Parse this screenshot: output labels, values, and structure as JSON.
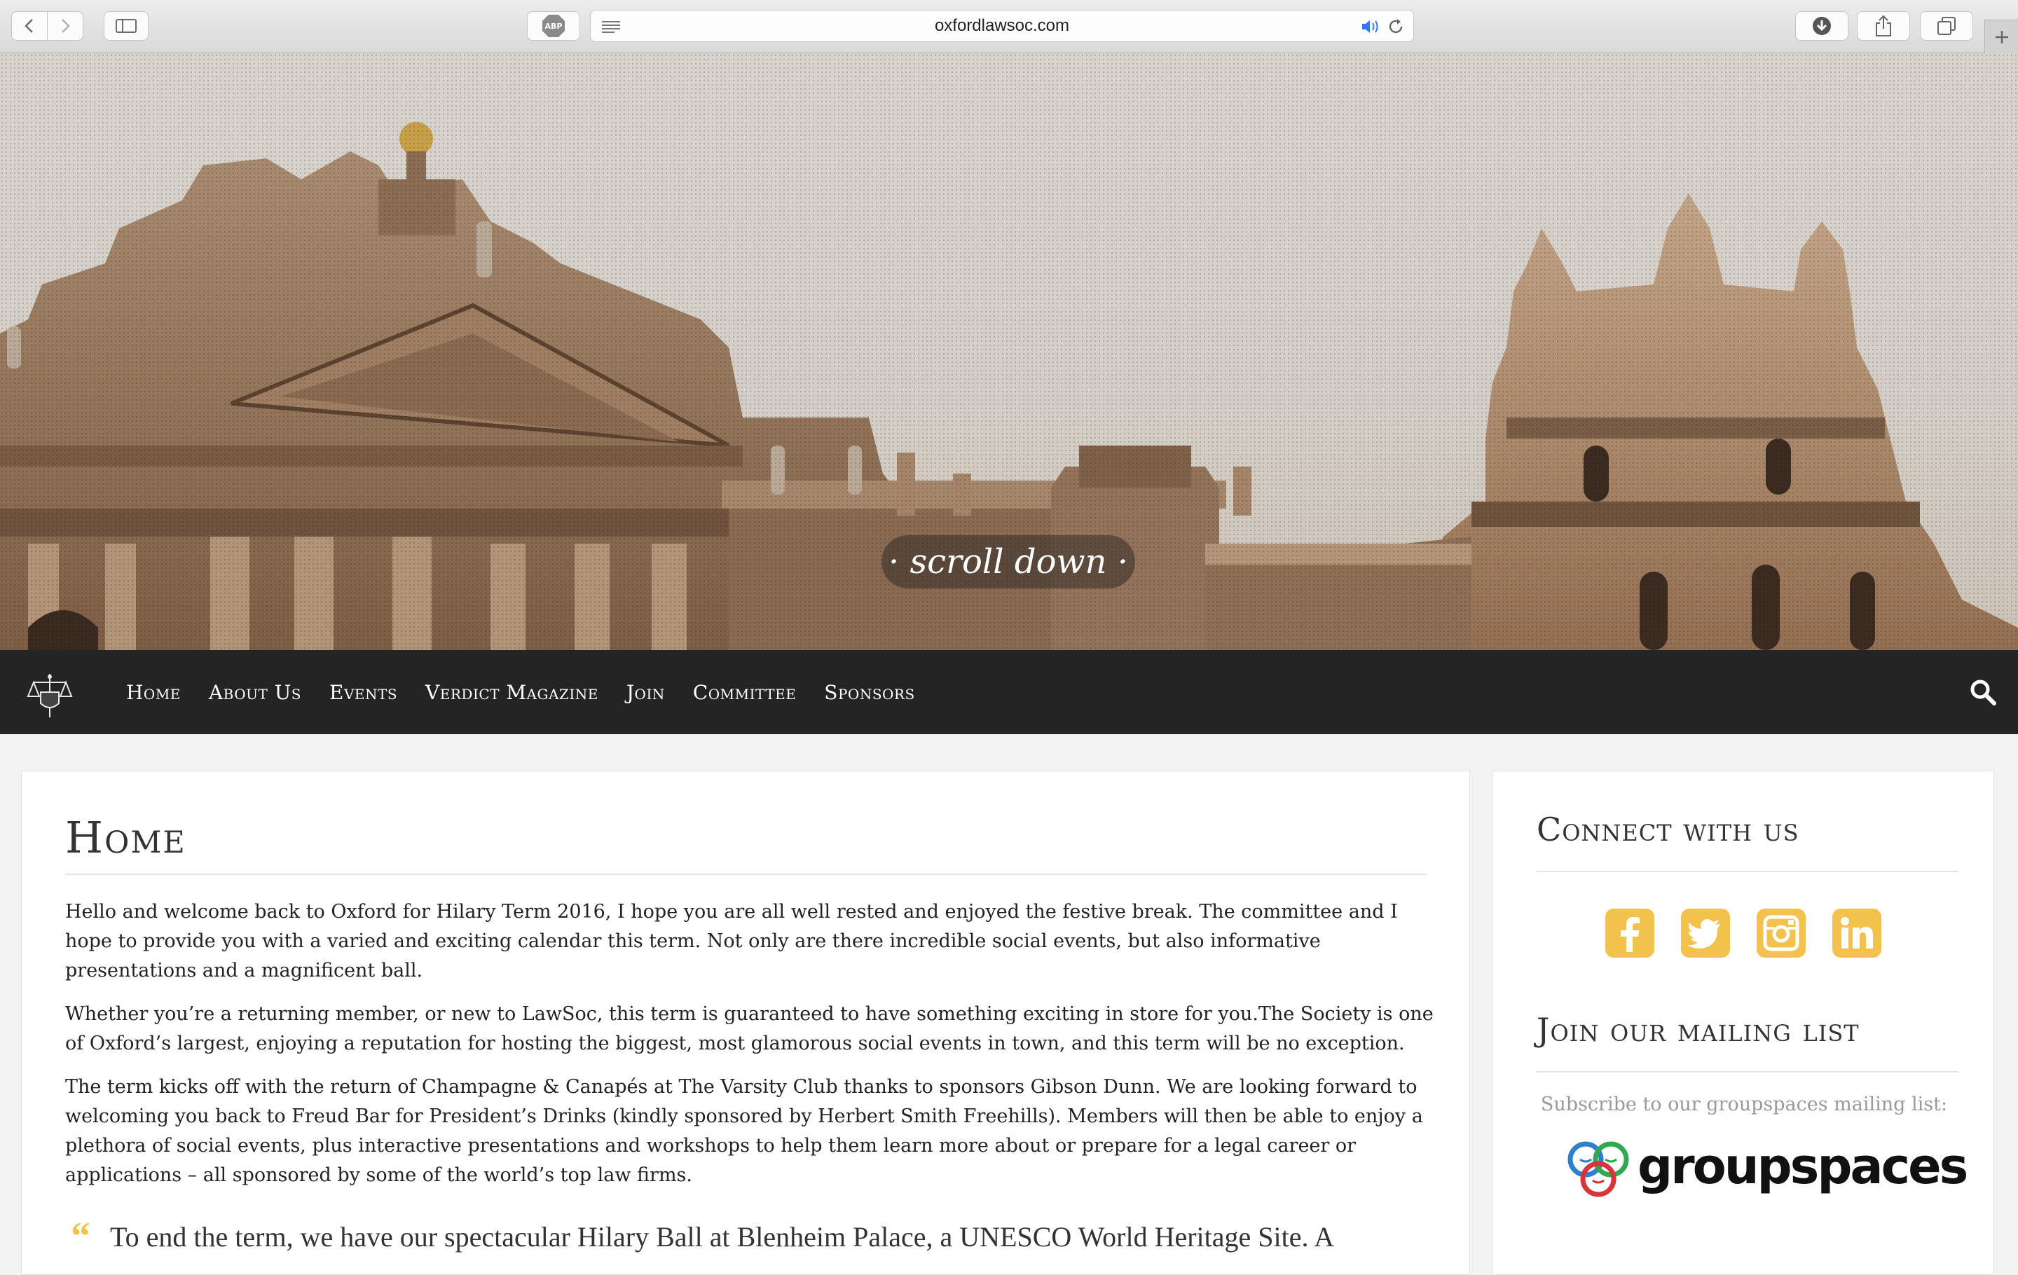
{
  "browser": {
    "url": "oxfordlawsoc.com",
    "abp_label": "ABP"
  },
  "hero": {
    "scroll_label": "· scroll down ·"
  },
  "nav": {
    "items": [
      "Home",
      "About Us",
      "Events",
      "Verdict Magazine",
      "Join",
      "Committee",
      "Sponsors"
    ]
  },
  "main": {
    "title": "Home",
    "paragraphs": [
      "Hello and welcome back to Oxford for Hilary Term 2016, I hope you are all well rested and enjoyed the festive break. The committee and I hope to provide you with a varied and exciting calendar this term. Not only are there incredible social events, but also informative presentations and a magnificent ball.",
      "Whether you’re a returning member, or new to LawSoc, this term is guaranteed to have something exciting in store for you.The Society is one of Oxford’s largest, enjoying a reputation for hosting the biggest, most glamorous social events in town, and this term will be no exception.",
      "The term kicks off with the return of Champagne & Canapés at The Varsity Club thanks to sponsors Gibson Dunn. We are looking forward to welcoming you back to Freud Bar for President’s Drinks (kindly sponsored by Herbert Smith Freehills). Members will then be able to enjoy a plethora of social events, plus interactive presentations and workshops to help them learn more about or prepare for a legal career or applications – all sponsored by some of the world’s top law firms."
    ],
    "quote_mark": "“",
    "quote": "To end the term, we have our spectacular Hilary Ball at Blenheim Palace, a UNESCO World Heritage Site. A"
  },
  "sidebar": {
    "connect_title": "Connect with us",
    "social": [
      "facebook-icon",
      "twitter-icon",
      "instagram-icon",
      "linkedin-icon"
    ],
    "mailing_title": "Join our mailing list",
    "subscribe_text": "Subscribe to our groupspaces mailing list:",
    "logo_text": "groupspaces"
  },
  "colors": {
    "accent": "#f3c24d",
    "nav_bg": "#242424"
  }
}
